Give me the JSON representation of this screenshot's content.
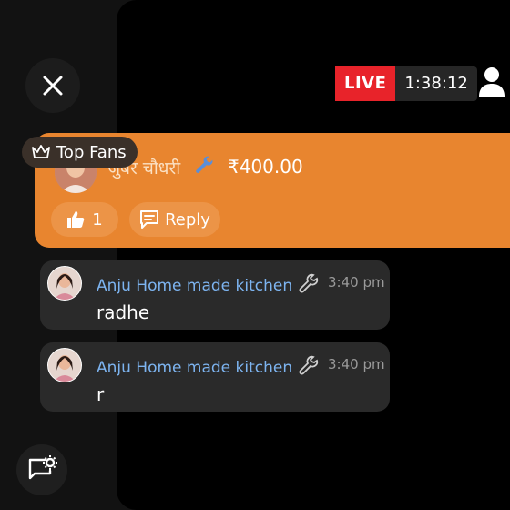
{
  "header": {
    "live_label": "LIVE",
    "elapsed_time": "1:38:12",
    "close_icon": "close-icon",
    "profile_icon": "person-icon"
  },
  "top_fans_label": "Top Fans",
  "super_chat": {
    "name": "जुबेर चौधरी",
    "amount": "₹400.00",
    "likes": "1",
    "reply_label": "Reply",
    "background": "#e8852f"
  },
  "messages": [
    {
      "name": "Anju Home made kitchen",
      "time": "3:40 pm",
      "text": "radhe"
    },
    {
      "name": "Anju Home made kitchen",
      "time": "3:40 pm",
      "text": "r"
    }
  ],
  "colors": {
    "live": "#e8232a",
    "username": "#7db4f0"
  },
  "footer": {
    "chat_settings_icon": "chat-settings-icon"
  }
}
